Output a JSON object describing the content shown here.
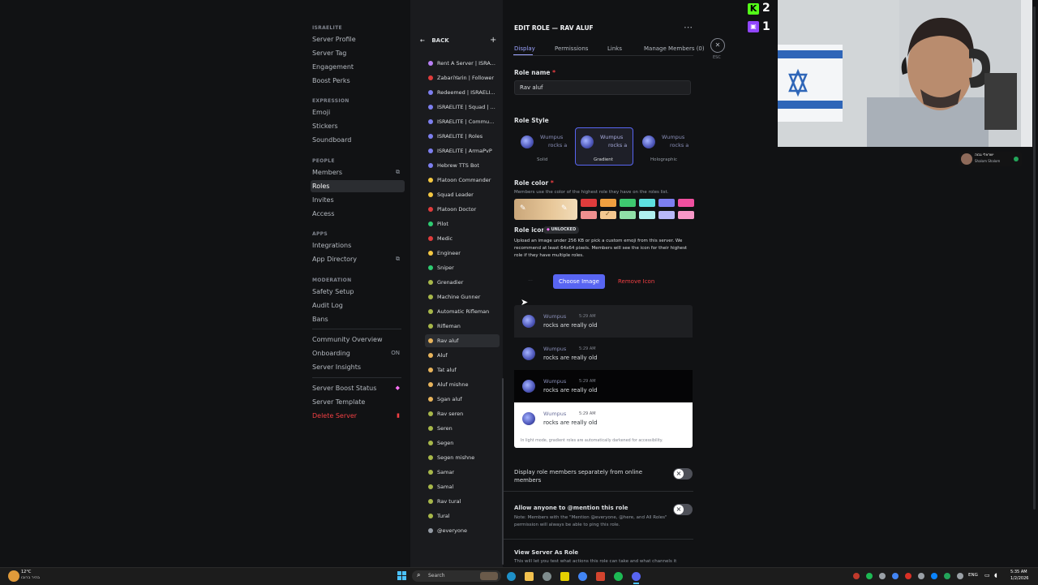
{
  "sidebar": {
    "sections": [
      {
        "header": "ISRAELITE",
        "items": [
          "Server Profile",
          "Server Tag",
          "Engagement",
          "Boost Perks"
        ]
      },
      {
        "header": "EXPRESSION",
        "items": [
          "Emoji",
          "Stickers",
          "Soundboard"
        ]
      },
      {
        "header": "PEOPLE",
        "items": [
          "Members",
          "Roles",
          "Invites",
          "Access"
        ]
      },
      {
        "header": "APPS",
        "items": [
          "Integrations",
          "App Directory"
        ]
      },
      {
        "header": "MODERATION",
        "items": [
          "Safety Setup",
          "Audit Log",
          "Bans"
        ]
      }
    ],
    "extra_items": [
      "Community Overview",
      "Onboarding",
      "Server Insights"
    ],
    "onboarding_status": "ON",
    "bottom_items": [
      "Server Boost Status",
      "Server Template"
    ],
    "delete_label": "Delete Server",
    "active_item": "Roles"
  },
  "roles_list": {
    "back_label": "BACK",
    "add_icon": "+",
    "roles": [
      {
        "name": "Rent A Server | ISRA...",
        "color": "#b87ff5"
      },
      {
        "name": "ZabariYarin | Follower",
        "color": "#e03c3c"
      },
      {
        "name": "Redeemed | ISRAELI...",
        "color": "#7d7ff0"
      },
      {
        "name": "ISRAELITE | Squad | ...",
        "color": "#7d7ff0"
      },
      {
        "name": "ISRAELITE | Commu...",
        "color": "#7d7ff0"
      },
      {
        "name": "ISRAELITE | Roles",
        "color": "#7d7ff0"
      },
      {
        "name": "ISRAELITE | ArmaPvP",
        "color": "#7d7ff0"
      },
      {
        "name": "Hebrew TTS Bot",
        "color": "#7d7ff0"
      },
      {
        "name": "Platoon Commander",
        "color": "#f5c842"
      },
      {
        "name": "Squad Leader",
        "color": "#f5c842"
      },
      {
        "name": "Platoon Doctor",
        "color": "#e03c3c"
      },
      {
        "name": "Pilot",
        "color": "#2ecc71"
      },
      {
        "name": "Medic",
        "color": "#e03c3c"
      },
      {
        "name": "Engineer",
        "color": "#f5c842"
      },
      {
        "name": "Sniper",
        "color": "#2ecc71"
      },
      {
        "name": "Grenadier",
        "color": "#a8b84a"
      },
      {
        "name": "Machine Gunner",
        "color": "#a8b84a"
      },
      {
        "name": "Automatic Rifleman",
        "color": "#a8b84a"
      },
      {
        "name": "Rifleman",
        "color": "#a8b84a"
      },
      {
        "name": "Rav aluf",
        "color": "#e8b45c"
      },
      {
        "name": "Aluf",
        "color": "#e8b45c"
      },
      {
        "name": "Tat aluf",
        "color": "#e8b45c"
      },
      {
        "name": "Aluf mishne",
        "color": "#e8b45c"
      },
      {
        "name": "Sgan aluf",
        "color": "#e8b45c"
      },
      {
        "name": "Rav seren",
        "color": "#a8b84a"
      },
      {
        "name": "Seren",
        "color": "#a8b84a"
      },
      {
        "name": "Segen",
        "color": "#a8b84a"
      },
      {
        "name": "Segen mishne",
        "color": "#a8b84a"
      },
      {
        "name": "Samar",
        "color": "#a8b84a"
      },
      {
        "name": "Samal",
        "color": "#a8b84a"
      },
      {
        "name": "Rav tural",
        "color": "#a8b84a"
      },
      {
        "name": "Tural",
        "color": "#a8b84a"
      },
      {
        "name": "@everyone",
        "color": "#949ba4"
      }
    ],
    "active_role": "Rav aluf"
  },
  "editor": {
    "title": "EDIT ROLE — RAV ALUF",
    "more_icon": "⋯",
    "close_icon": "✕",
    "esc_label": "ESC",
    "tabs": [
      "Display",
      "Permissions",
      "Links",
      "Manage Members (0)"
    ],
    "active_tab": "Display",
    "role_name_label": "Role name",
    "required_marker": "*",
    "role_name_value": "Rav aluf",
    "role_style_label": "Role Style",
    "preview_name": "Wumpus",
    "preview_text_short": "rocks a",
    "styles": [
      "Solid",
      "Gradient",
      "Holographic"
    ],
    "selected_style": "Gradient",
    "role_color_label": "Role color",
    "role_color_help": "Members use the color of the highest role they have on the roles list.",
    "role_icon_label": "Role icon",
    "unlocked_label": "UNLOCKED",
    "role_icon_help": "Upload an image under 256 KB or pick a custom emoji from this server. We recommend at least 64x64 pixels. Members will see the icon for their highest role if they have multiple roles.",
    "choose_image_label": "Choose Image",
    "remove_icon_label": "Remove Icon",
    "messages": [
      {
        "name": "Wumpus",
        "time": "5:29 AM",
        "text": "rocks are really old"
      },
      {
        "name": "Wumpus",
        "time": "5:29 AM",
        "text": "rocks are really old"
      },
      {
        "name": "Wumpus",
        "time": "5:29 AM",
        "text": "rocks are really old"
      },
      {
        "name": "Wumpus",
        "time": "5:29 AM",
        "text": "rocks are really old"
      }
    ],
    "light_mode_note": "In light mode, gradient roles are automatically darkened for accessibility.",
    "display_separately_label": "Display role members separately from online members",
    "mention_label": "Allow anyone to @mention this role",
    "mention_note": "Note: Members with the \"Mention @everyone, @here, and All Roles\" permission will always be able to ping this role.",
    "view_as_label": "View Server As Role",
    "view_as_note": "This will let you test what actions this role can take and what channels it"
  },
  "colors": {
    "swatches_top": [
      "#e03c3c",
      "#f0a040",
      "#3ec970",
      "#5ee0e0",
      "#7d7ff0",
      "#f050a0"
    ],
    "swatches_bottom": [
      "#f09090",
      "#f5c890",
      "#90e0a8",
      "#b0f0f0",
      "#b8b8f8",
      "#f898c8"
    ],
    "accent": "#5865f2",
    "danger": "#f23f43"
  },
  "overlay": {
    "kick_count": "2",
    "twitch_count": "1",
    "notif_name": "ישראלי גבוה",
    "notif_sub": "Shalom Shalom"
  },
  "taskbar": {
    "weather_temp": "12°C",
    "weather_desc": "בהיר ברובו",
    "search_placeholder": "Search",
    "lang": "ENG",
    "time": "5:35 AM",
    "date": "1/2/2026"
  }
}
